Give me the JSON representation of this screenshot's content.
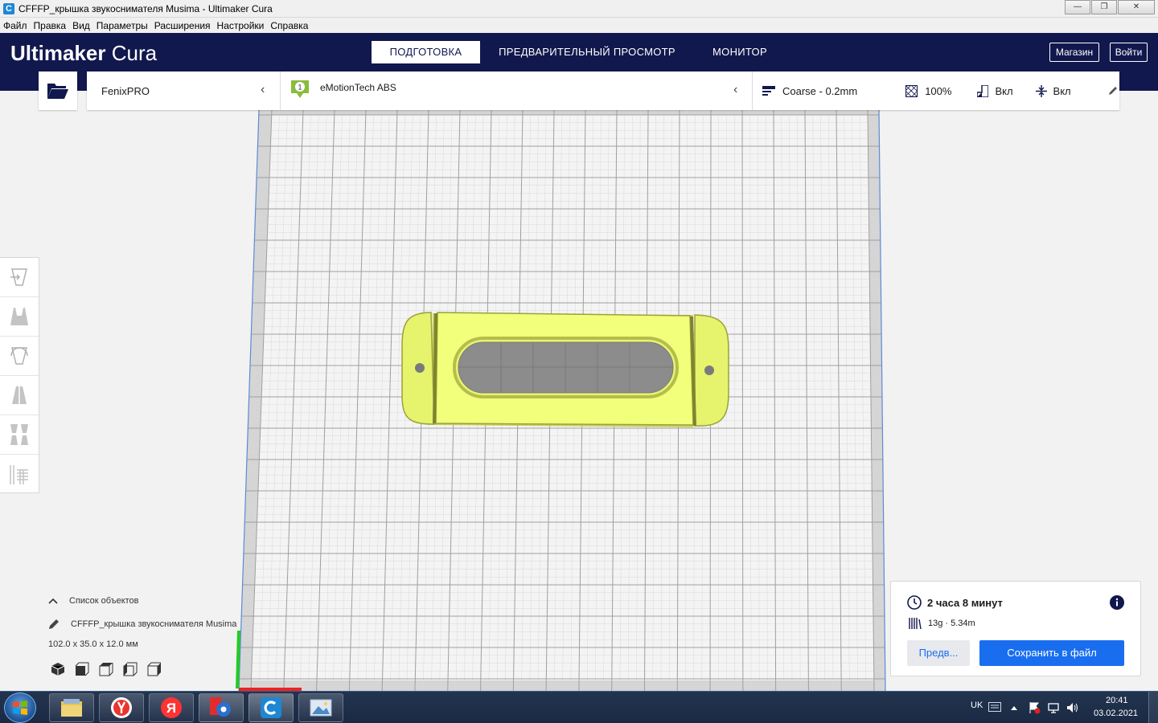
{
  "window": {
    "title": "CFFFP_крышка звукоснимателя Musima - Ultimaker Cura",
    "buttons": [
      "—",
      "❐",
      "✕"
    ]
  },
  "menu": [
    "Файл",
    "Правка",
    "Вид",
    "Параметры",
    "Расширения",
    "Настройки",
    "Справка"
  ],
  "header": {
    "logo_bold": "Ultimaker",
    "logo_light": "Cura",
    "tabs": [
      "ПОДГОТОВКА",
      "ПРЕДВАРИТЕЛЬНЫЙ ПРОСМОТР",
      "МОНИТОР"
    ],
    "active_tab": 0,
    "marketplace": "Магазин",
    "signin": "Войти"
  },
  "printer_panel": {
    "printer": "FenixPRO",
    "extruder_number": "1",
    "material": "eMotionTech ABS",
    "profile": "Coarse - 0.2mm",
    "infill": "100%",
    "support": "Вкл",
    "adhesion": "Вкл"
  },
  "object_list": {
    "header": "Список объектов",
    "object_name": "CFFFP_крышка звукоснимателя Musima",
    "dimensions": "102.0 x 35.0 x 12.0 мм"
  },
  "print_info": {
    "time": "2 часа 8 минут",
    "material_usage": "13g · 5.34m",
    "preview_button": "Предв...",
    "save_button": "Сохранить в файл"
  },
  "tray": {
    "language": "UK",
    "time": "20:41",
    "date": "03.02.2021"
  },
  "colors": {
    "header_bg": "#11184d",
    "accent": "#196ef0",
    "model": "#f2ff7a"
  }
}
